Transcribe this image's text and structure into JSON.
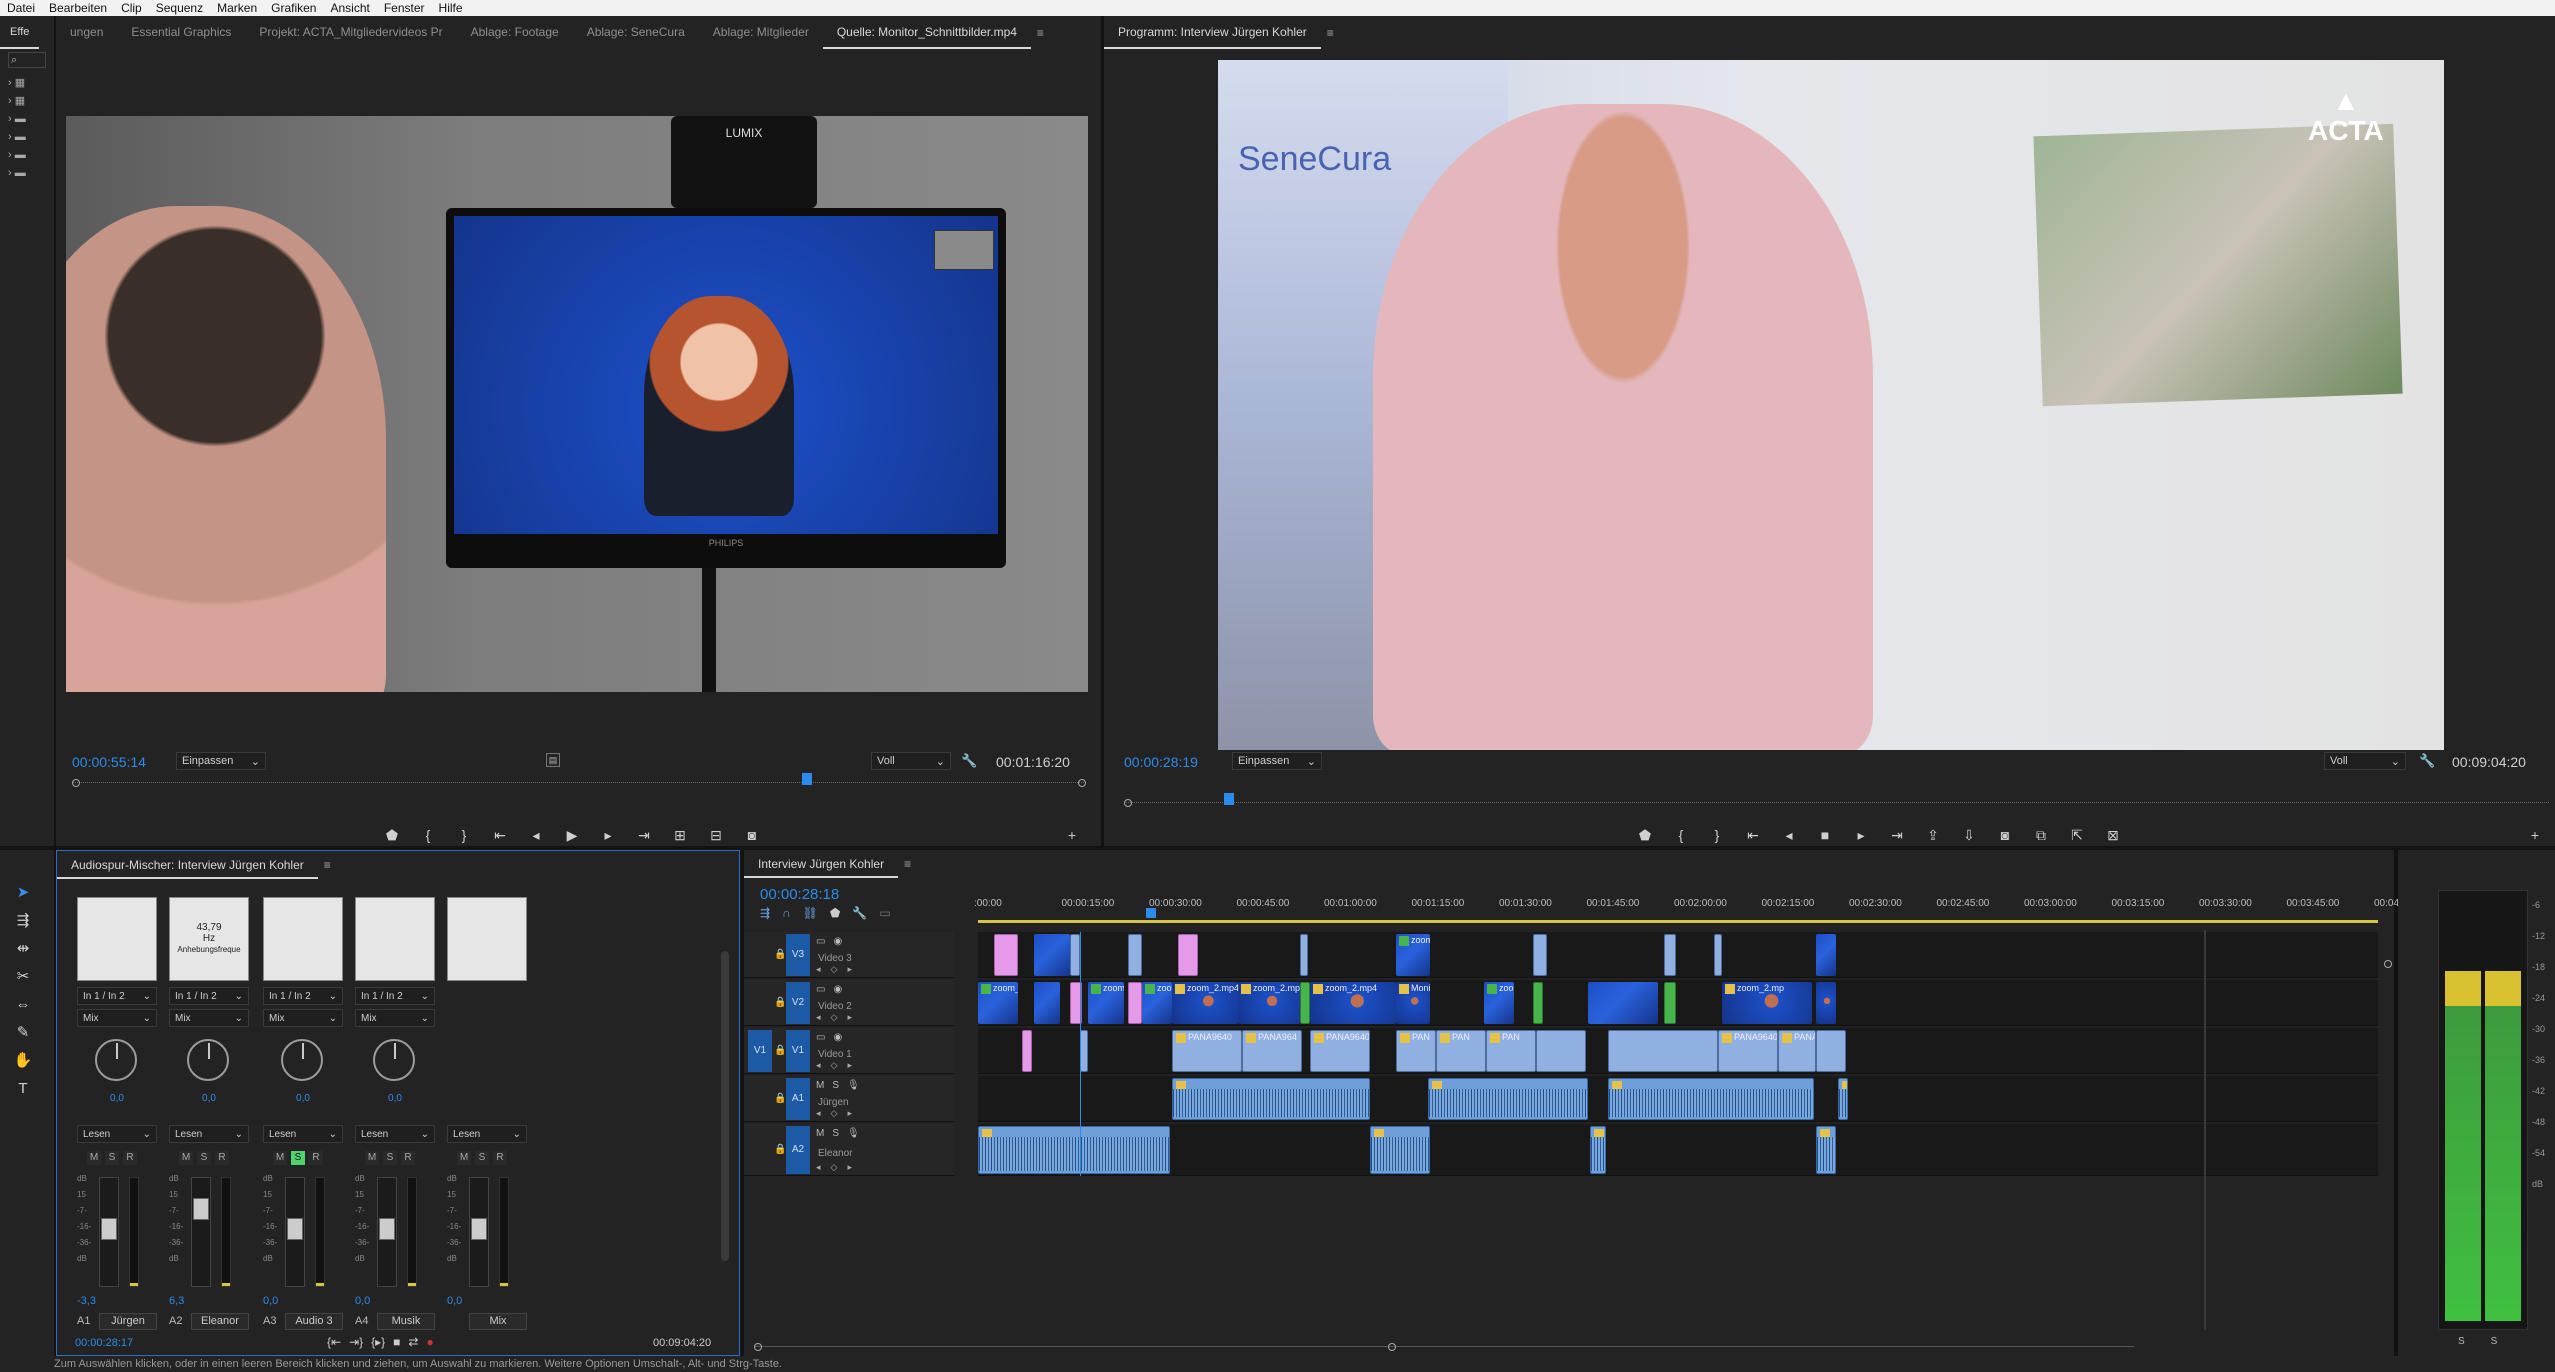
{
  "menu": [
    "Datei",
    "Bearbeiten",
    "Clip",
    "Sequenz",
    "Marken",
    "Grafiken",
    "Ansicht",
    "Fenster",
    "Hilfe"
  ],
  "project_panel": {
    "tab": "Effe"
  },
  "source_monitor": {
    "tabs": [
      "ungen",
      "Essential Graphics",
      "Projekt: ACTA_Mitgliedervideos Pr",
      "Ablage: Footage",
      "Ablage: SeneCura",
      "Ablage: Mitglieder",
      "Quelle: Monitor_Schnittbilder.mp4"
    ],
    "active_tab": "Quelle: Monitor_Schnittbilder.mp4",
    "timecode": "00:00:55:14",
    "fit": "Einpassen",
    "quality": "Voll",
    "duration": "00:01:16:20",
    "screen_brand": "PHILIPS",
    "camera_brand": "LUMIX",
    "progress": 0.72
  },
  "program_monitor": {
    "title": "Programm: Interview Jürgen Kohler",
    "timecode": "00:00:28:19",
    "fit": "Einpassen",
    "quality": "Voll",
    "duration": "00:09:04:20",
    "overlay_logo": "ACTA",
    "banner_text": "SeneCura",
    "progress": 0.07
  },
  "audio_mixer": {
    "title": "Audiospur-Mischer: Interview Jürgen Kohler",
    "channels": [
      {
        "input": "In 1 / In 2",
        "mode": "Mix",
        "value": "0,0",
        "read": "Lesen",
        "fader": "-3,3",
        "track": "A1",
        "name": "Jürgen"
      },
      {
        "input": "In 1 / In 2",
        "mode": "Mix",
        "value": "0,0",
        "read": "Lesen",
        "fader": "6,3",
        "track": "A2",
        "name": "Eleanor",
        "effect_value": "43,79",
        "effect_unit": "Hz",
        "effect_label": "Anhebungsfreque"
      },
      {
        "input": "In 1 / In 2",
        "mode": "Mix",
        "value": "0,0",
        "read": "Lesen",
        "fader": "0,0",
        "track": "A3",
        "name": "Audio 3"
      },
      {
        "input": "In 1 / In 2",
        "mode": "Mix",
        "value": "0,0",
        "read": "Lesen",
        "fader": "0,0",
        "track": "A4",
        "name": "Musik"
      },
      {
        "input": "",
        "mode": "",
        "value": "",
        "read": "Lesen",
        "fader": "0,0",
        "track": "",
        "name": "Mix"
      }
    ],
    "db_scale": [
      "dB",
      "15",
      "-7-",
      "-16-",
      "-36-",
      "dB"
    ],
    "time_left": "00:00:28:17",
    "time_right": "00:09:04:20"
  },
  "timeline": {
    "title": "Interview Jürgen Kohler",
    "timecode": "00:00:28:18",
    "ruler": [
      ":00:00",
      "00:00:15:00",
      "00:00:30:00",
      "00:00:45:00",
      "00:01:00:00",
      "00:01:15:00",
      "00:01:30:00",
      "00:01:45:00",
      "00:02:00:00",
      "00:02:15:00",
      "00:02:30:00",
      "00:02:45:00",
      "00:03:00:00",
      "00:03:15:00",
      "00:03:30:00",
      "00:03:45:00",
      "00:04:00"
    ],
    "tracks": [
      {
        "id": "V3",
        "name": "Video 3"
      },
      {
        "id": "V2",
        "name": "Video 2"
      },
      {
        "id": "V1",
        "name": "Video 1",
        "source": "V1"
      },
      {
        "id": "A1",
        "name": "Jürgen"
      },
      {
        "id": "A2",
        "name": "Eleanor"
      }
    ],
    "clip_labels": {
      "zoom": "zoom",
      "zoom_": "zoom_",
      "zoo": "zoo",
      "zoom2v": "zoom_2.mp4 [V]",
      "zoom2": "zoom_2.mp4",
      "zoom2short": "zoom_2.mp",
      "monit": "Monit",
      "pana1": "PANA9640",
      "pana2": "PANA964",
      "pana3": "PANA9640.MP4",
      "pan": "PAN",
      "pana": "PANA"
    }
  },
  "master_meter": {
    "scale": [
      "-6",
      "-12",
      "-18",
      "-24",
      "-30",
      "-36",
      "-42",
      "-48",
      "-54",
      "dB"
    ],
    "solo": [
      "S",
      "S"
    ]
  },
  "status": "Zum Auswählen klicken, oder in einen leeren Bereich klicken und ziehen, um Auswahl zu markieren. Weitere Optionen Umschalt-, Alt- und Strg-Taste."
}
